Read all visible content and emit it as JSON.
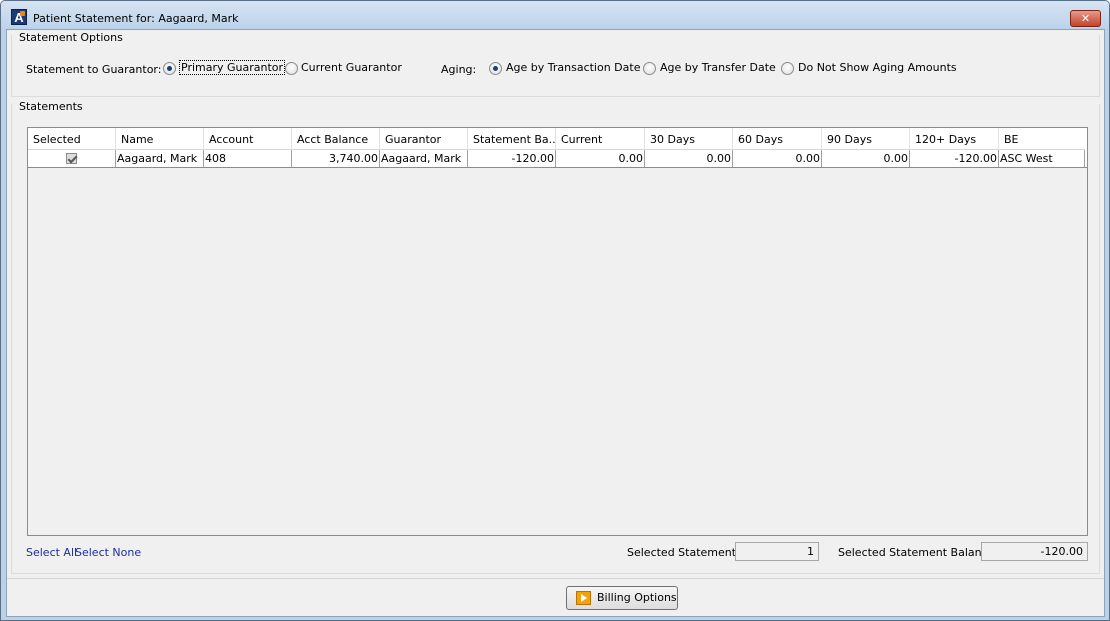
{
  "window": {
    "title": "Patient Statement for: Aagaard, Mark",
    "close_glyph": "✕"
  },
  "options": {
    "group_title": "Statement Options",
    "guarantor_label": "Statement to Guarantor:",
    "guarantor_choices": [
      {
        "label": "Primary Guarantor",
        "selected": true
      },
      {
        "label": "Current Guarantor",
        "selected": false
      }
    ],
    "aging_label": "Aging:",
    "aging_choices": [
      {
        "label": "Age by Transaction Date",
        "selected": true
      },
      {
        "label": "Age by Transfer Date",
        "selected": false
      },
      {
        "label": "Do Not Show Aging Amounts",
        "selected": false
      }
    ]
  },
  "statements": {
    "group_title": "Statements",
    "columns": [
      "Selected",
      "Name",
      "Account",
      "Acct Balance",
      "Guarantor",
      "Statement Ba...",
      "Current",
      "30 Days",
      "60 Days",
      "90 Days",
      "120+ Days",
      "BE"
    ],
    "rows": [
      {
        "selected": true,
        "name": "Aagaard, Mark",
        "account": "408",
        "acct_balance": "3,740.00",
        "guarantor": "Aagaard, Mark",
        "statement_balance": "-120.00",
        "current": "0.00",
        "days_30": "0.00",
        "days_60": "0.00",
        "days_90": "0.00",
        "days_120_plus": "-120.00",
        "be": "ASC West"
      }
    ]
  },
  "footer": {
    "select_all": "Select All",
    "select_none": "Select None",
    "selected_statements_label": "Selected Statements:",
    "selected_statements_value": "1",
    "selected_balance_label": "Selected Statement Balance:",
    "selected_balance_value": "-120.00"
  },
  "actions": {
    "billing_options": "Billing Options"
  },
  "icons": {
    "app": "app-logo-icon",
    "billing": "play-icon"
  },
  "colors": {
    "link": "#1a2ea0",
    "titlebar": "#bcd2ea",
    "billing_icon": "#f2a20c"
  }
}
